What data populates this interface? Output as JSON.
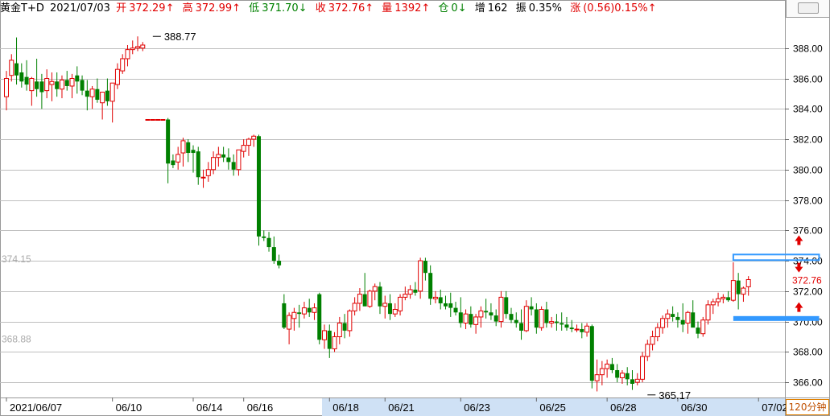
{
  "header": {
    "symbol": "黄金T+D",
    "date": "2021/07/03",
    "open_label": "开",
    "open": "372.29↑",
    "high_label": "高",
    "high": "372.99↑",
    "low_label": "低",
    "low": "371.70↓",
    "close_label": "收",
    "close": "372.76↑",
    "volume_label": "量",
    "volume": "1392↑",
    "position_label": "仓",
    "position": "0↓",
    "increase_label": "增",
    "increase": "162",
    "amplitude_label": "振",
    "amplitude": "0.35%",
    "change_label": "涨",
    "change": "(0.56)0.15%↑"
  },
  "period_label": "120分钟",
  "colors": {
    "up": "#e00000",
    "down": "#008000",
    "grid": "#bfbfbf",
    "highlight": "#3399ff",
    "axis_strip": "#cfe1f5"
  },
  "chart_data": {
    "type": "candlestick",
    "ylim": [
      365.0,
      390.0
    ],
    "y_ticks": [
      366,
      368,
      370,
      372,
      374,
      376,
      378,
      380,
      382,
      384,
      386,
      388
    ],
    "y_tick_labels": [
      "366.00",
      "368.00",
      "370.00",
      "372.00",
      "374.00",
      "376.00",
      "378.00",
      "380.00",
      "382.00",
      "384.00",
      "386.00",
      "388.00"
    ],
    "x_labels": [
      {
        "label": "2021/06/07",
        "index": 0
      },
      {
        "label": "06/10",
        "index": 21
      },
      {
        "label": "06/14",
        "index": 37
      },
      {
        "label": "06/16",
        "index": 47
      },
      {
        "label": "06/18",
        "index": 64
      },
      {
        "label": "06/21",
        "index": 75
      },
      {
        "label": "06/23",
        "index": 90
      },
      {
        "label": "06/25",
        "index": 105
      },
      {
        "label": "06/28",
        "index": 119
      },
      {
        "label": "06/30",
        "index": 133
      },
      {
        "label": "07/02",
        "index": 149
      }
    ],
    "left_labels": [
      {
        "label": "374.15",
        "value": 374.15
      },
      {
        "label": "368.88",
        "value": 368.88
      }
    ],
    "annotations": [
      {
        "label": "388.77",
        "value": 388.77,
        "index": 29
      },
      {
        "label": "365.17",
        "value": 365.17,
        "index": 127
      }
    ],
    "last_price": {
      "label": "372.76",
      "value": 372.76
    },
    "candles": [
      [
        384.8,
        386.5,
        383.9,
        386.0
      ],
      [
        386.2,
        387.6,
        385.8,
        387.2
      ],
      [
        387.0,
        388.7,
        385.6,
        386.2
      ],
      [
        386.4,
        387.0,
        385.4,
        385.8
      ],
      [
        386.1,
        387.2,
        385.2,
        385.6
      ],
      [
        385.2,
        386.1,
        384.2,
        386.0
      ],
      [
        385.8,
        387.3,
        384.8,
        385.3
      ],
      [
        385.8,
        386.3,
        384.0,
        385.1
      ],
      [
        385.2,
        386.6,
        384.7,
        386.0
      ],
      [
        385.6,
        386.4,
        384.5,
        385.8
      ],
      [
        385.8,
        386.4,
        384.8,
        385.3
      ],
      [
        385.3,
        386.2,
        384.7,
        385.9
      ],
      [
        385.9,
        386.5,
        385.2,
        385.5
      ],
      [
        385.5,
        386.3,
        384.7,
        386.0
      ],
      [
        386.2,
        386.8,
        385.0,
        385.8
      ],
      [
        385.9,
        386.2,
        384.9,
        385.2
      ],
      [
        385.2,
        385.9,
        383.9,
        384.8
      ],
      [
        384.8,
        385.5,
        384.0,
        385.3
      ],
      [
        385.3,
        386.0,
        384.4,
        384.6
      ],
      [
        384.4,
        385.1,
        383.3,
        385.1
      ],
      [
        385.2,
        386.0,
        384.2,
        384.5
      ],
      [
        384.5,
        385.6,
        383.1,
        385.7
      ],
      [
        385.6,
        387.0,
        385.3,
        386.6
      ],
      [
        386.5,
        387.6,
        386.3,
        387.3
      ],
      [
        387.3,
        388.2,
        386.8,
        387.9
      ],
      [
        387.9,
        388.5,
        387.6,
        388.0
      ],
      [
        388.0,
        388.77,
        387.8,
        388.1
      ],
      [
        388.0,
        388.4,
        387.8,
        388.2
      ],
      [
        383.3,
        383.3,
        383.3,
        383.3
      ],
      [
        383.3,
        383.3,
        383.3,
        383.3
      ],
      [
        383.3,
        383.3,
        383.3,
        383.3
      ],
      [
        383.3,
        383.3,
        383.3,
        383.3
      ],
      [
        383.3,
        383.4,
        379.1,
        380.4
      ],
      [
        380.6,
        381.0,
        380.1,
        380.3
      ],
      [
        380.5,
        381.5,
        380.0,
        381.0
      ],
      [
        381.1,
        382.1,
        380.2,
        381.9
      ],
      [
        381.8,
        382.0,
        380.5,
        381.1
      ],
      [
        381.3,
        381.6,
        379.8,
        381.1
      ],
      [
        381.2,
        381.5,
        379.0,
        379.5
      ],
      [
        379.5,
        380.0,
        378.8,
        379.5
      ],
      [
        379.6,
        380.5,
        379.2,
        380.0
      ],
      [
        380.0,
        381.2,
        379.7,
        380.8
      ],
      [
        380.8,
        381.5,
        380.2,
        381.0
      ],
      [
        381.0,
        381.5,
        380.5,
        380.8
      ],
      [
        380.8,
        381.4,
        380.0,
        380.5
      ],
      [
        380.5,
        381.0,
        379.6,
        380.0
      ],
      [
        380.0,
        381.2,
        379.6,
        381.3
      ],
      [
        381.2,
        382.0,
        380.8,
        381.6
      ],
      [
        381.6,
        382.1,
        380.9,
        382.0
      ],
      [
        382.0,
        382.3,
        381.5,
        382.2
      ],
      [
        382.2,
        382.3,
        375.0,
        375.6
      ],
      [
        375.6,
        376.0,
        375.3,
        375.5
      ],
      [
        375.5,
        375.9,
        374.6,
        374.9
      ],
      [
        374.9,
        375.6,
        373.8,
        374.0
      ],
      [
        374.0,
        374.4,
        373.5,
        373.7
      ],
      [
        371.2,
        371.8,
        369.5,
        369.6
      ],
      [
        369.5,
        370.6,
        368.5,
        370.4
      ],
      [
        370.2,
        370.9,
        369.4,
        370.6
      ],
      [
        370.6,
        371.1,
        369.6,
        370.5
      ],
      [
        370.5,
        371.3,
        370.2,
        370.9
      ],
      [
        370.9,
        371.5,
        370.3,
        370.6
      ],
      [
        370.6,
        371.2,
        370.1,
        370.9
      ],
      [
        371.8,
        371.9,
        368.5,
        368.8
      ],
      [
        368.8,
        369.8,
        368.2,
        369.4
      ],
      [
        369.4,
        369.8,
        367.6,
        368.2
      ],
      [
        368.2,
        369.3,
        368.0,
        369.0
      ],
      [
        369.0,
        370.3,
        368.5,
        369.9
      ],
      [
        369.9,
        370.5,
        368.9,
        369.4
      ],
      [
        369.4,
        370.8,
        369.0,
        370.7
      ],
      [
        370.7,
        371.6,
        370.4,
        371.2
      ],
      [
        371.2,
        372.2,
        370.7,
        371.8
      ],
      [
        371.8,
        373.2,
        371.3,
        371.0
      ],
      [
        371.0,
        372.1,
        370.9,
        372.0
      ],
      [
        372.0,
        372.5,
        371.4,
        372.3
      ],
      [
        372.3,
        372.6,
        370.5,
        371.0
      ],
      [
        371.0,
        371.7,
        370.2,
        371.2
      ],
      [
        371.2,
        371.8,
        370.1,
        370.5
      ],
      [
        370.5,
        371.2,
        370.3,
        370.8
      ],
      [
        370.7,
        371.8,
        370.4,
        371.6
      ],
      [
        371.6,
        372.3,
        371.4,
        371.8
      ],
      [
        371.8,
        372.4,
        371.5,
        372.1
      ],
      [
        372.1,
        372.6,
        371.7,
        371.9
      ],
      [
        372.0,
        374.2,
        371.5,
        374.0
      ],
      [
        374.0,
        374.2,
        372.7,
        373.2
      ],
      [
        373.2,
        373.7,
        371.1,
        371.5
      ],
      [
        371.5,
        372.0,
        371.2,
        371.6
      ],
      [
        371.6,
        372.1,
        370.8,
        371.2
      ],
      [
        371.2,
        371.7,
        370.8,
        371.0
      ],
      [
        371.2,
        371.9,
        370.3,
        370.9
      ],
      [
        370.9,
        371.3,
        370.4,
        370.6
      ],
      [
        370.6,
        371.6,
        369.6,
        369.9
      ],
      [
        369.9,
        370.8,
        369.5,
        370.5
      ],
      [
        370.5,
        371.0,
        369.6,
        369.8
      ],
      [
        369.8,
        370.5,
        369.2,
        370.3
      ],
      [
        370.3,
        371.0,
        369.6,
        370.7
      ],
      [
        370.7,
        371.5,
        370.2,
        370.6
      ],
      [
        370.6,
        371.2,
        370.1,
        370.4
      ],
      [
        370.4,
        370.8,
        369.7,
        370.0
      ],
      [
        370.0,
        372.0,
        369.6,
        371.6
      ],
      [
        371.6,
        372.0,
        370.2,
        370.5
      ],
      [
        370.5,
        370.9,
        369.9,
        370.1
      ],
      [
        370.1,
        370.6,
        369.6,
        369.9
      ],
      [
        369.9,
        370.8,
        368.8,
        369.4
      ],
      [
        369.4,
        371.4,
        369.3,
        371.0
      ],
      [
        371.0,
        371.6,
        370.4,
        370.8
      ],
      [
        370.8,
        371.2,
        369.2,
        369.6
      ],
      [
        369.6,
        371.0,
        369.4,
        370.8
      ],
      [
        370.8,
        371.3,
        369.6,
        369.9
      ],
      [
        369.9,
        370.3,
        369.6,
        370.0
      ],
      [
        370.0,
        370.5,
        369.4,
        369.9
      ],
      [
        369.9,
        370.6,
        369.4,
        369.8
      ],
      [
        369.8,
        370.3,
        369.4,
        369.6
      ],
      [
        369.6,
        370.1,
        369.3,
        369.5
      ],
      [
        369.5,
        369.8,
        369.3,
        369.5
      ],
      [
        369.5,
        369.9,
        368.9,
        369.3
      ],
      [
        369.3,
        369.9,
        369.0,
        369.7
      ],
      [
        369.7,
        369.8,
        365.6,
        366.1
      ],
      [
        366.1,
        367.5,
        365.4,
        366.5
      ],
      [
        366.5,
        367.4,
        365.8,
        366.9
      ],
      [
        366.9,
        367.5,
        366.3,
        367.2
      ],
      [
        367.2,
        367.6,
        366.6,
        366.8
      ],
      [
        366.8,
        367.2,
        366.0,
        366.3
      ],
      [
        366.3,
        366.8,
        365.9,
        366.6
      ],
      [
        366.6,
        367.0,
        365.8,
        366.2
      ],
      [
        366.2,
        366.8,
        365.5,
        365.9
      ],
      [
        366.0,
        366.6,
        365.8,
        366.2
      ],
      [
        366.2,
        368.0,
        366.0,
        367.7
      ],
      [
        367.7,
        368.8,
        367.4,
        368.5
      ],
      [
        368.5,
        369.4,
        368.1,
        369.0
      ],
      [
        369.0,
        369.9,
        368.7,
        369.6
      ],
      [
        369.6,
        370.4,
        369.2,
        370.2
      ],
      [
        370.2,
        370.8,
        369.6,
        370.5
      ],
      [
        370.5,
        371.0,
        370.0,
        370.3
      ],
      [
        370.3,
        370.6,
        369.6,
        370.1
      ],
      [
        370.1,
        371.2,
        369.3,
        369.8
      ],
      [
        369.9,
        370.7,
        369.2,
        370.6
      ],
      [
        370.6,
        371.4,
        369.8,
        369.6
      ],
      [
        369.6,
        370.0,
        368.9,
        369.2
      ],
      [
        369.2,
        370.3,
        369.0,
        370.1
      ],
      [
        370.1,
        371.4,
        369.8,
        371.1
      ],
      [
        371.1,
        371.5,
        370.5,
        371.3
      ],
      [
        371.3,
        371.9,
        371.0,
        371.5
      ],
      [
        371.5,
        371.8,
        371.2,
        371.6
      ],
      [
        371.6,
        372.0,
        371.3,
        371.4
      ],
      [
        371.4,
        373.9,
        371.3,
        372.7
      ],
      [
        372.7,
        373.2,
        370.8,
        371.8
      ],
      [
        371.8,
        372.3,
        371.3,
        372.2
      ],
      [
        372.29,
        372.99,
        371.7,
        372.76
      ]
    ],
    "highlight_boxes": [
      {
        "value": 374.2,
        "index_start": 144,
        "index_end": 161,
        "style": "outline"
      },
      {
        "value": 370.2,
        "index_start": 144,
        "index_end": 161,
        "style": "solid"
      }
    ],
    "markers": [
      {
        "value": 375.3,
        "index": 157,
        "symbol": "up"
      },
      {
        "value": 373.6,
        "index": 157,
        "symbol": "down"
      },
      {
        "value": 370.9,
        "index": 157,
        "symbol": "up"
      }
    ]
  }
}
